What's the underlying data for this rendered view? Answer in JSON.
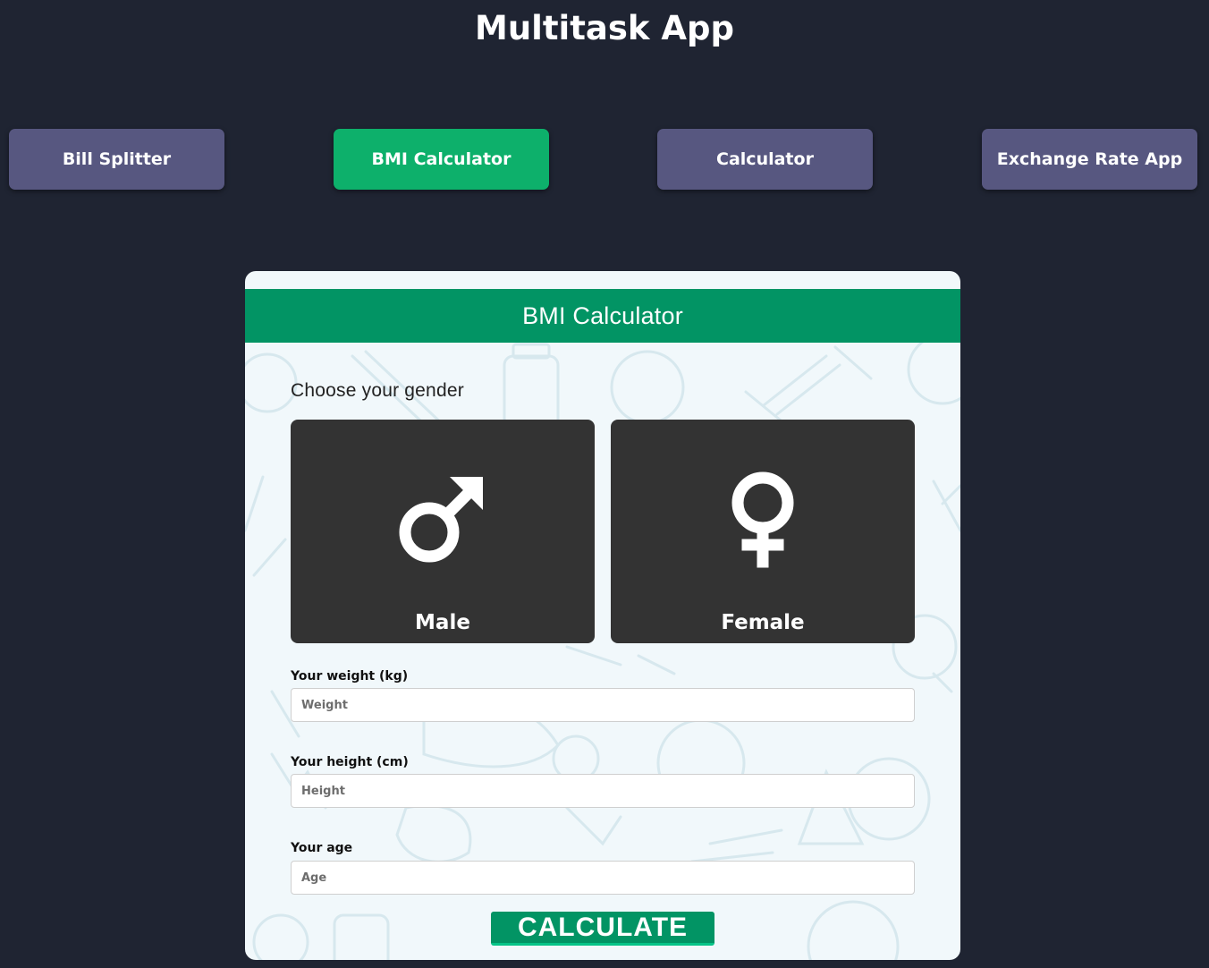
{
  "app": {
    "title": "Multitask App"
  },
  "nav": {
    "items": [
      {
        "label": "Bill Splitter",
        "active": false
      },
      {
        "label": "BMI Calculator",
        "active": true
      },
      {
        "label": "Calculator",
        "active": false
      },
      {
        "label": "Exchange Rate App",
        "active": false
      }
    ]
  },
  "bmi": {
    "header": "BMI Calculator",
    "gender_prompt": "Choose your gender",
    "genders": [
      {
        "label": "Male",
        "icon": "male-symbol-icon"
      },
      {
        "label": "Female",
        "icon": "female-symbol-icon"
      }
    ],
    "fields": {
      "weight": {
        "label": "Your weight (kg)",
        "placeholder": "Weight",
        "value": ""
      },
      "height": {
        "label": "Your height (cm)",
        "placeholder": "Height",
        "value": ""
      },
      "age": {
        "label": "Your age",
        "placeholder": "Age",
        "value": ""
      }
    },
    "calculate_label": "CALCULATE"
  },
  "colors": {
    "page_bg": "#1f2432",
    "nav_button": "#575780",
    "nav_button_active": "#0db06b",
    "accent_green": "#029464",
    "card_bg": "#f1f8fb",
    "gender_tile": "#333333"
  }
}
